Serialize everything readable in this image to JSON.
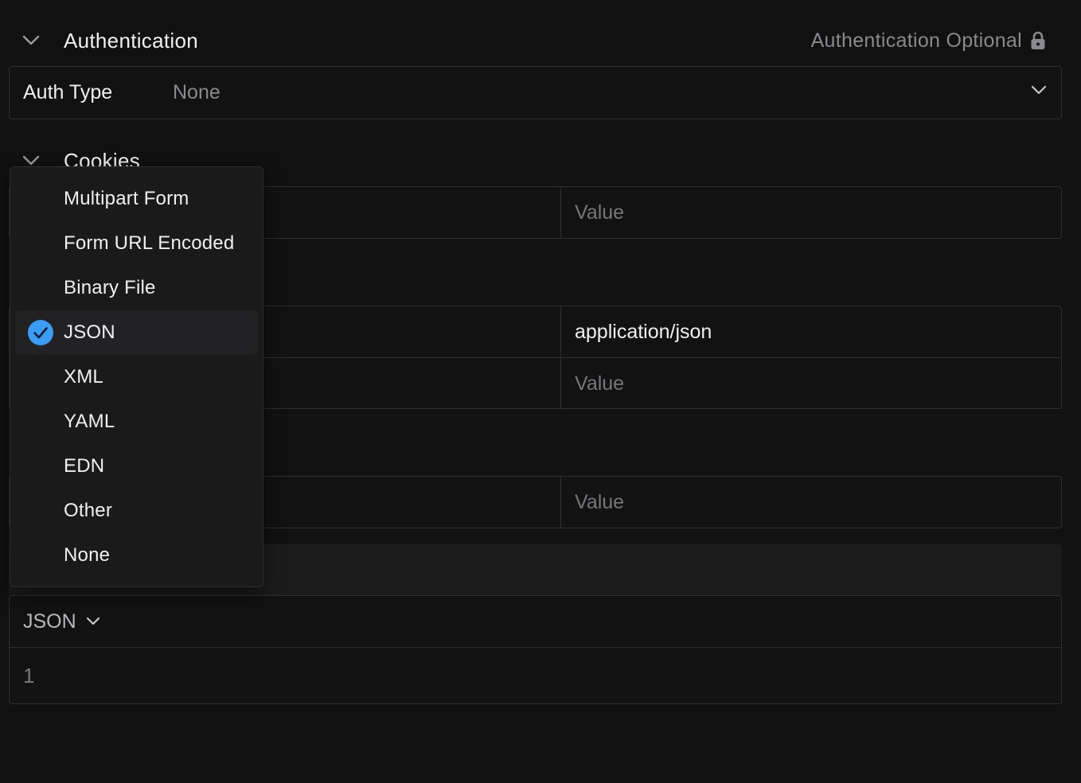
{
  "authentication": {
    "title": "Authentication",
    "optional_label": "Authentication Optional",
    "auth_type_label": "Auth Type",
    "auth_type_value": "None"
  },
  "cookies": {
    "title": "Cookies",
    "rows": [
      {
        "value": "Value",
        "is_placeholder": true
      }
    ]
  },
  "headers": {
    "rows": [
      {
        "value": "application/json",
        "is_placeholder": false
      },
      {
        "value": "Value",
        "is_placeholder": true
      }
    ]
  },
  "query": {
    "rows": [
      {
        "value": "Value",
        "is_placeholder": true
      }
    ]
  },
  "body": {
    "format_label": "JSON",
    "line_numbers": [
      "1"
    ]
  },
  "content_type_menu": {
    "items": [
      {
        "label": "Multipart Form",
        "selected": false
      },
      {
        "label": "Form URL Encoded",
        "selected": false
      },
      {
        "label": "Binary File",
        "selected": false
      },
      {
        "label": "JSON",
        "selected": true
      },
      {
        "label": "XML",
        "selected": false
      },
      {
        "label": "YAML",
        "selected": false
      },
      {
        "label": "EDN",
        "selected": false
      },
      {
        "label": "Other",
        "selected": false
      },
      {
        "label": "None",
        "selected": false
      }
    ]
  },
  "colors": {
    "background": "#111112",
    "accent": "#3b9cf5",
    "muted_text": "#8a8a8e",
    "border": "#2f2f33"
  },
  "icons": {
    "chevron": "chevron-down-icon",
    "lock": "lock-icon",
    "check": "check-circle-icon"
  }
}
